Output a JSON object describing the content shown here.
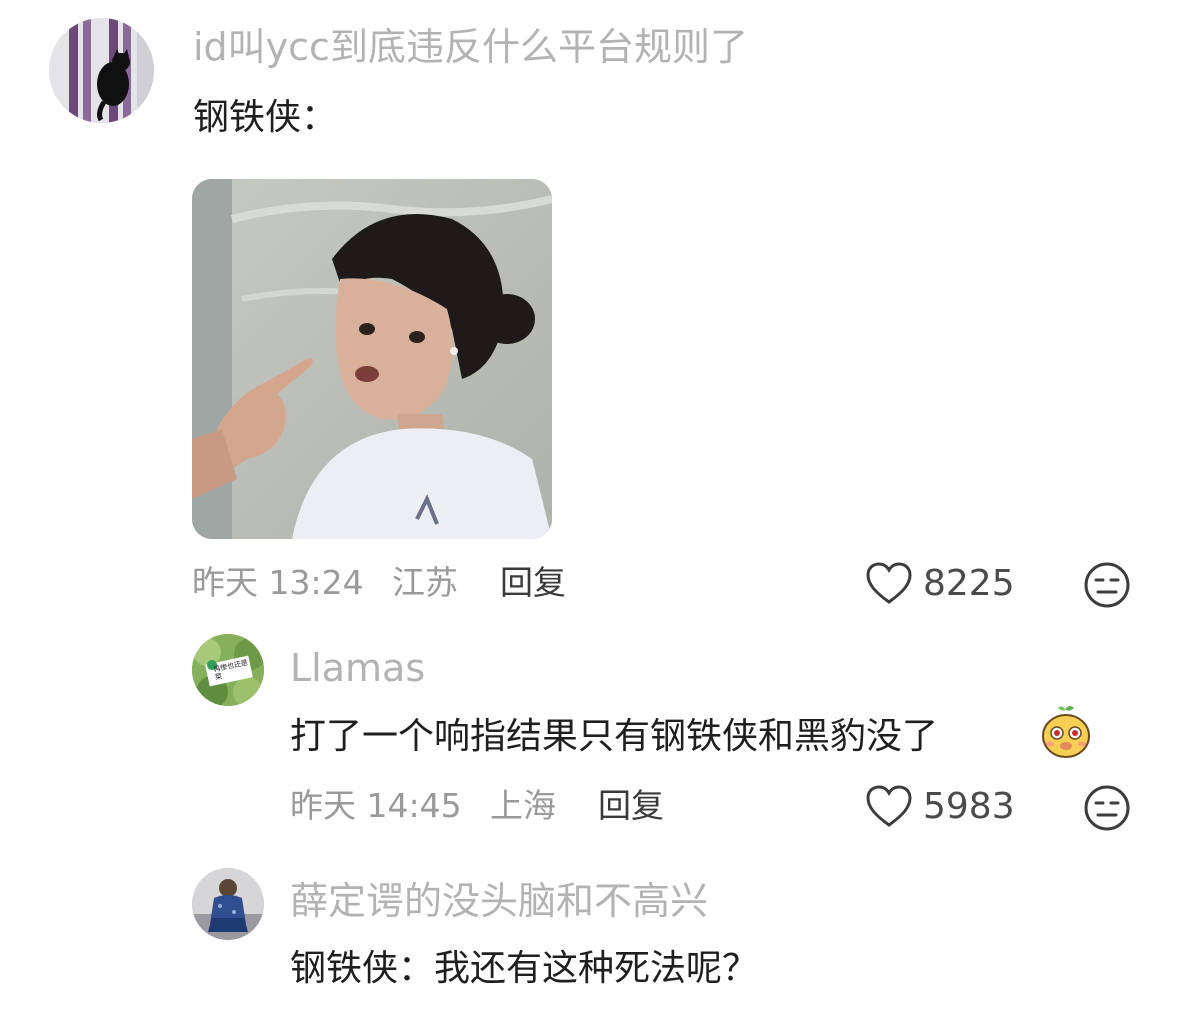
{
  "comments": [
    {
      "username": "id叫ycc到底违反什么平台规则了",
      "text": "钢铁侠：",
      "time": "昨天 13:24",
      "location": "江苏",
      "reply_label": "回复",
      "likes": "8225",
      "avatar_icon": "black-cat-avatar",
      "image": "girl-pointing-photo"
    },
    {
      "username": "Llamas",
      "text": "打了一个响指结果只有钢铁侠和黑豹没了",
      "emoji": "cute-face-emoji",
      "time": "昨天 14:45",
      "location": "上海",
      "reply_label": "回复",
      "likes": "5983",
      "avatar_icon": "vegetable-avatar",
      "avatar_text": "再惨也还是菜"
    },
    {
      "username": "薛定谔的没头脑和不高兴",
      "text": "钢铁侠：我还有这种死法呢？",
      "avatar_icon": "person-avatar"
    }
  ],
  "icons": {
    "like": "heart-outline-icon",
    "dislike": "unamused-face-icon"
  },
  "colors": {
    "username": "#b3b3b3",
    "text": "#1f1f1f",
    "meta": "#9a9a9a",
    "reply": "#3a3a3a"
  }
}
